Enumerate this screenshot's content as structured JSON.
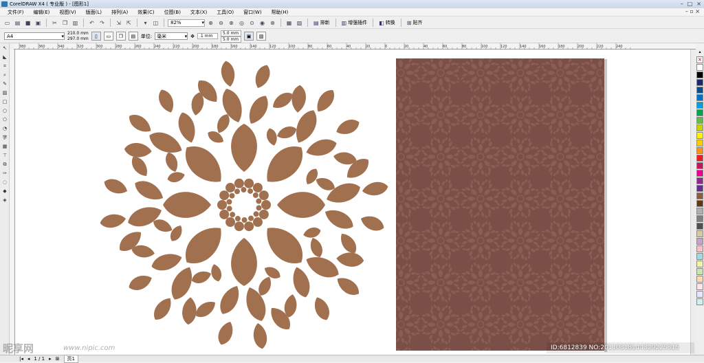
{
  "window": {
    "title": "CorelDRAW X4 ( 专业版 ) - [图形1]",
    "controls": [
      "–",
      "□",
      "×"
    ]
  },
  "menubar": {
    "items": [
      "文件(F)",
      "编辑(E)",
      "视图(V)",
      "版面(L)",
      "排列(A)",
      "效果(C)",
      "位图(B)",
      "文本(X)",
      "工具(O)",
      "窗口(W)",
      "帮助(H)"
    ],
    "right_controls": "– ▫ ×"
  },
  "toolbar": {
    "zoom": "82%",
    "plugins": [
      {
        "label": "排新",
        "icon": "layout-icon"
      },
      {
        "label": "增强插件",
        "icon": "plugin-icon"
      },
      {
        "label": "转换",
        "icon": "convert-icon"
      },
      {
        "label": "贴齐",
        "icon": "snap-icon"
      }
    ]
  },
  "property_bar": {
    "page_size": "A4",
    "width": "210.0 mm",
    "height": "297.0 mm",
    "units_label": "单位:",
    "units": "毫米",
    "nudge": ".1 mm",
    "dup_x": "5.0 mm",
    "dup_y": "5.0 mm"
  },
  "ruler_labels": [
    "380",
    "360",
    "340",
    "320",
    "300",
    "280",
    "260",
    "240",
    "220",
    "200",
    "180",
    "160",
    "140",
    "120",
    "100",
    "80",
    "60",
    "40",
    "20",
    "0",
    "20",
    "40",
    "60",
    "80",
    "100",
    "120",
    "140",
    "160",
    "180",
    "200",
    "220",
    "240"
  ],
  "statusbar": {
    "page_nav": "1 / 1",
    "page_tab": "页1"
  },
  "watermark": {
    "logo_text": "昵享网",
    "url": "www.nipic.com",
    "id_text": "ID:6812839 NO:20110318144329225315"
  },
  "colors": {
    "motif": "#a0704f",
    "pattern_bg": "#7a4f47",
    "pattern_motif": "#8c5d53",
    "palette": [
      "#ffffff",
      "#000000",
      "#1b2a6b",
      "#0a4f8b",
      "#0073c8",
      "#00a0e0",
      "#00a651",
      "#66bb44",
      "#c8d400",
      "#fff200",
      "#ffcc00",
      "#f7941d",
      "#ed1c24",
      "#c2185b",
      "#ec008c",
      "#92278f",
      "#662d91",
      "#8b5e3c",
      "#603913",
      "#b0b0b0",
      "#808080",
      "#505050",
      "#d9c9a0",
      "#c6a2c9",
      "#f9c0cc",
      "#a4d7e1",
      "#f4f4a0",
      "#c8e6b0",
      "#fdd9b5",
      "#ffe6e6",
      "#e6e6ff",
      "#d0f0f0"
    ]
  }
}
